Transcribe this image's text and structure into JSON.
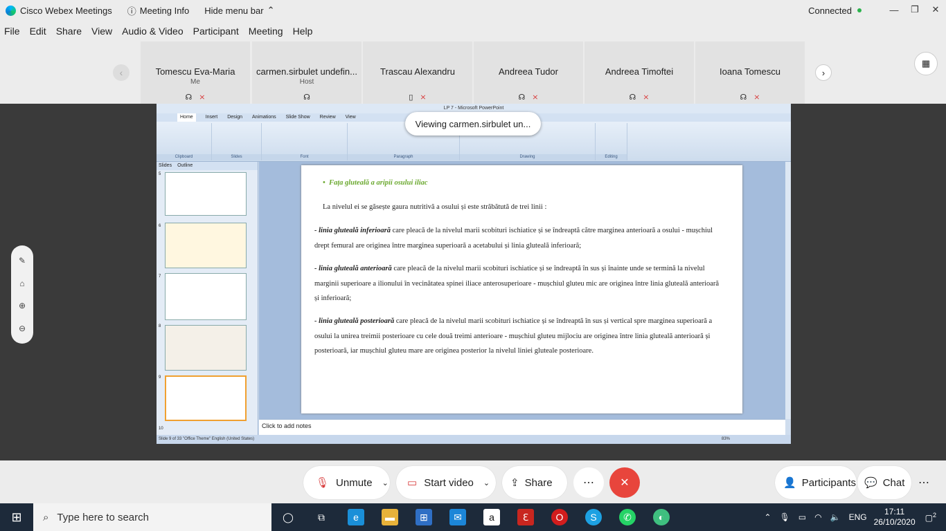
{
  "titlebar": {
    "app_name": "Cisco Webex Meetings",
    "meeting_info": "Meeting Info",
    "hide_menu": "Hide menu bar",
    "status": "Connected"
  },
  "menu": [
    "File",
    "Edit",
    "Share",
    "View",
    "Audio & Video",
    "Participant",
    "Meeting",
    "Help"
  ],
  "participants": [
    {
      "name": "Tomescu Eva-Maria",
      "sub": "Me"
    },
    {
      "name": "carmen.sirbulet undefin...",
      "sub": "Host"
    },
    {
      "name": "Trascau Alexandru",
      "sub": ""
    },
    {
      "name": "Andreea Tudor",
      "sub": ""
    },
    {
      "name": "Andreea Timoftei",
      "sub": ""
    },
    {
      "name": "Ioana Tomescu",
      "sub": ""
    }
  ],
  "viewing_banner": "Viewing carmen.sirbulet un...",
  "ppt": {
    "title": "LP 7 - Microsoft PowerPoint",
    "tabs": [
      "Home",
      "Insert",
      "Design",
      "Animations",
      "Slide Show",
      "Review",
      "View"
    ],
    "groups": [
      "Clipboard",
      "Slides",
      "Font",
      "Paragraph",
      "Drawing",
      "Editing"
    ],
    "pane_tabs": [
      "Slides",
      "Outline"
    ],
    "thumb_numbers": [
      "5",
      "6",
      "7",
      "8",
      "9",
      "10"
    ],
    "notes": "Click to add notes",
    "status": "Slide 9 of 33    \"Office Theme\"    English (United States)",
    "zoom": "83%"
  },
  "slide": {
    "heading": "Fața gluteală a aripii osului iliac",
    "intro": "La nivelul ei se găsește gaura nutritivă a osului și este străbătută de trei linii :",
    "p1_bold": "- linia gluteală inferioară",
    "p1_rest": " care pleacă de la nivelul marii scobituri ischiatice și se îndreaptă către marginea anterioară a osului - mușchiul drept femural are originea între marginea superioară a acetabului și linia gluteală  inferioară;",
    "p2_bold": "- linia gluteală anterioară",
    "p2_rest": " care pleacă de la nivelul marii scobituri ischiatice și se îndreaptă în sus și înainte unde se termină la nivelul marginii superioare a ilionului în vecinătatea spinei iliace anterosuperioare - mușchiul gluteu mic are originea între linia gluteală anterioară și inferioară;",
    "p3_bold": "- linia gluteală posterioară",
    "p3_rest": " care pleacă de la nivelul marii scobituri ischiatice și se îndreaptă în sus și vertical spre marginea superioară a osului la unirea treimii posterioare cu cele două treimi anterioare - mușchiul gluteu mijlociu are originea între linia gluteală anterioară și posterioară, iar mușchiul gluteu mare are originea posterior la nivelul liniei gluteale posterioare."
  },
  "controls": {
    "unmute": "Unmute",
    "start_video": "Start video",
    "share": "Share",
    "participants": "Participants",
    "chat": "Chat"
  },
  "taskbar": {
    "search_placeholder": "Type here to search",
    "lang": "ENG",
    "time": "17:11",
    "date": "26/10/2020",
    "notif_count": "2"
  },
  "colors": {
    "accent_red": "#e8453c",
    "muted_red": "#d83b3b",
    "connected_green": "#2bb24c",
    "slide_heading_green": "#6aa82e"
  }
}
